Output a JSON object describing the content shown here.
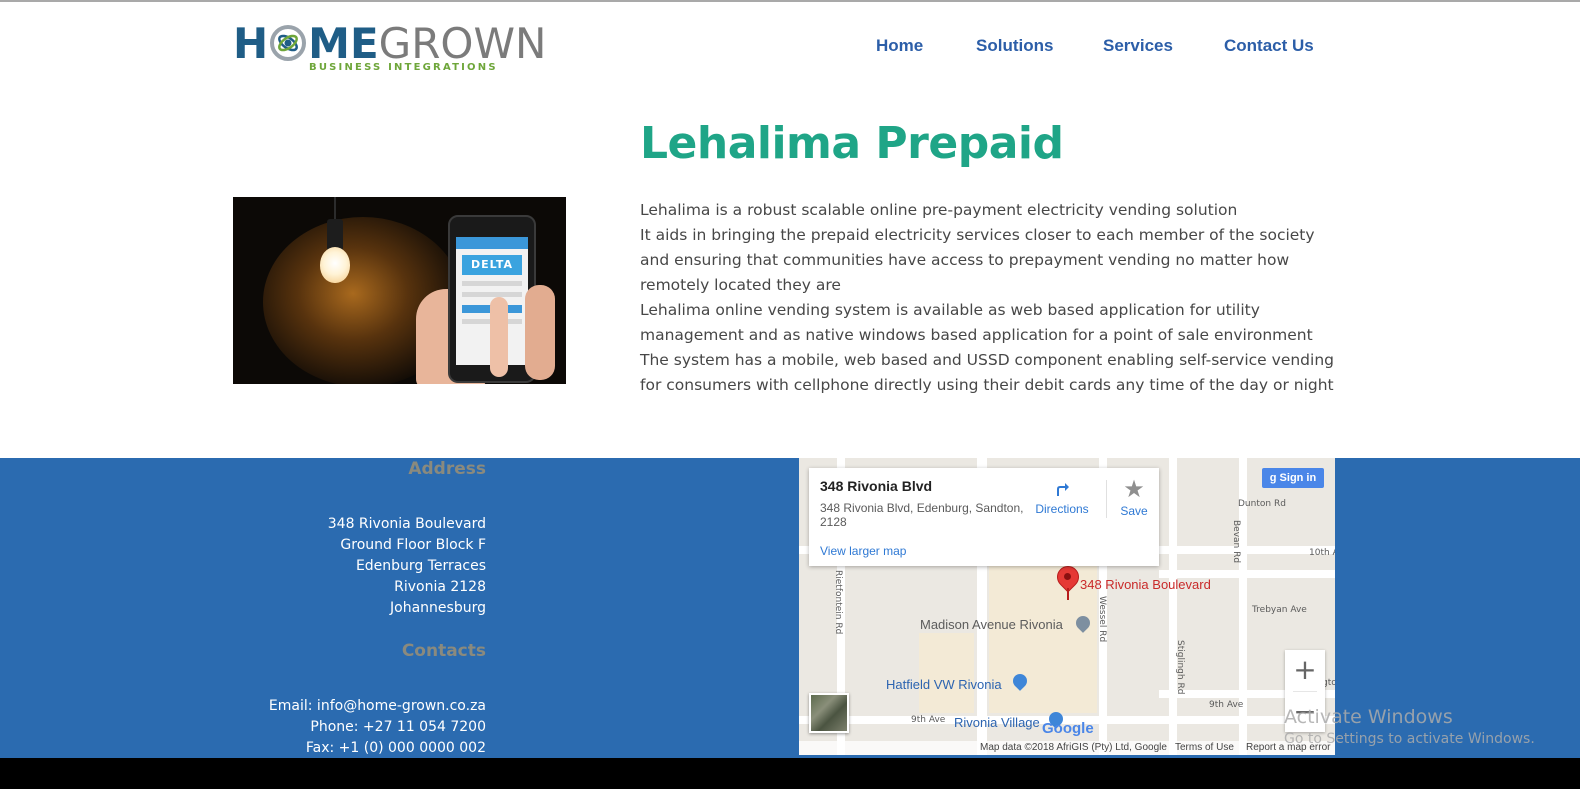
{
  "brand": {
    "logo_text_h": "H",
    "logo_text_me": "ME",
    "logo_text_grown": "GROWN",
    "logo_subtitle": "BUSINESS INTEGRATIONS"
  },
  "nav": {
    "items": [
      {
        "label": "Home"
      },
      {
        "label": "Solutions"
      },
      {
        "label": "Services"
      },
      {
        "label": "Contact Us"
      }
    ]
  },
  "main": {
    "title": "Lehalima Prepaid",
    "hero_phone_brand": "DELTA",
    "paragraphs": [
      "Lehalima is a robust scalable online pre-payment electricity vending solution",
      "It aids in bringing the prepaid electricity services closer to each member of the society and ensuring that communities have access to prepayment vending no matter how remotely located they are",
      "Lehalima online vending system is available as web based application for utility management and as native windows based application for a point of sale environment",
      "The system has a mobile, web based and USSD component enabling self-service vending for consumers with cellphone directly using their debit cards any time of the day or night"
    ]
  },
  "footer": {
    "address_heading": "Address",
    "address_lines": [
      "348 Rivonia Boulevard",
      "Ground Floor Block F",
      "Edenburg Terraces",
      "Rivonia 2128",
      "Johannesburg"
    ],
    "contacts_heading": "Contacts",
    "email": "Email: info@home-grown.co.za",
    "phone": "Phone: +27 11 054 7200",
    "fax": "Fax: +1 (0) 000 0000 002"
  },
  "map": {
    "card_title": "348 Rivonia Blvd",
    "card_address": "348 Rivonia Blvd, Edenburg, Sandton, 2128",
    "directions_label": "Directions",
    "save_label": "Save",
    "view_larger_label": "View larger map",
    "sign_in_label": "Sign in",
    "marker_label": "348 Rivonia Boulevard",
    "poi_madison": "Madison Avenue Rivonia",
    "poi_hatfield": "Hatfield VW Rivonia",
    "poi_village": "Rivonia Village",
    "street_dunton": "Dunton Rd",
    "street_10th": "10th A",
    "street_trebyan": "Trebyan Ave",
    "street_craigton": "Craigto",
    "street_9th_left": "9th Ave",
    "street_9th_right": "9th Ave",
    "street_bevan": "Bevan Rd",
    "street_stiglingh": "Stiglingh Rd",
    "street_wessel": "Wessel Rd",
    "street_rietfontein": "Rietfontein Rd",
    "google_text": "Google",
    "attribution_data": "Map data ©2018 AfriGIS (Pty) Ltd, Google",
    "attribution_terms": "Terms of Use",
    "attribution_report": "Report a map error",
    "zoom_in": "+",
    "zoom_out": "−"
  },
  "os_watermark": {
    "line1": "Activate Windows",
    "line2": "Go to Settings to activate Windows."
  },
  "colors": {
    "nav_text": "#2c5ea8",
    "title_teal": "#1fa587",
    "footer_blue": "#2b6bb0",
    "footer_heading": "#8a8a7e",
    "logo_blue": "#1f5d86",
    "logo_green": "#6ea63a"
  }
}
